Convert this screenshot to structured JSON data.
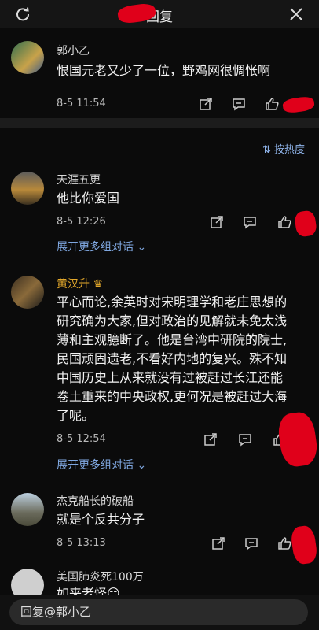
{
  "header": {
    "title": "回复"
  },
  "main_comment": {
    "username": "郭小乙",
    "text": "恨国元老又少了一位，野鸡网很惆怅啊",
    "time": "8-5 11:54"
  },
  "sort": {
    "label": "按热度"
  },
  "replies": [
    {
      "username": "天涯五更",
      "text": "他比你爱国",
      "time": "8-5 12:26",
      "expand_label": "展开更多组对话"
    },
    {
      "username": "黄汉升",
      "badge": "crown",
      "text_lines": [
        "平心而论,余英时对宋明理学和老庄思想的",
        "研究确为大家,但对政治的见解就未免太浅",
        "薄和主观臆断了。他是台湾中研院的院士,",
        "民国顽固遗老,不看好内地的复兴。殊不知",
        "中国历史上从来就没有过被赶过长江还能",
        "卷土重来的中央政权,更何况是被赶过大海",
        "了呢。"
      ],
      "time": "8-5 12:54",
      "expand_label": "展开更多组对话"
    },
    {
      "username": "杰克船长的破船",
      "text": "就是个反共分子",
      "time": "8-5 13:13"
    },
    {
      "username": "美国肺炎死100万",
      "text": "如来老怪😏"
    }
  ],
  "reply_input": {
    "placeholder": "回复@郭小乙"
  },
  "colors": {
    "background": "#0b0b0b",
    "link": "#7fa7e0",
    "redaction": "#e0001a"
  }
}
